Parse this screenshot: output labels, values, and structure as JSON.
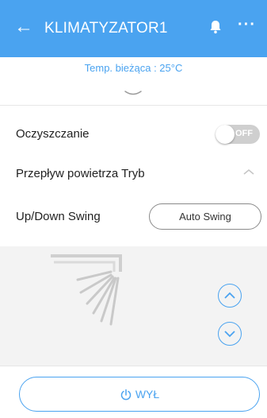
{
  "header": {
    "title": "KLIMATYZATOR1",
    "back_icon": "arrow-left-icon",
    "bell_icon": "bell-icon",
    "more_icon": "more-icon"
  },
  "temperature": {
    "label": "Temp. bieżąca : 25°C"
  },
  "rows": {
    "cleaning_label": "Oczyszczanie",
    "cleaning_toggle_text": "OFF",
    "airflow_label": "Przepływ powietrza Tryb",
    "swing_label": "Up/Down Swing",
    "swing_mode": "Auto Swing"
  },
  "power": {
    "label": "WYŁ"
  },
  "colors": {
    "accent": "#4aa3f0",
    "header_bg": "#4aa3f0",
    "toggle_off": "#cfcfcf",
    "panel_bg": "#f3f3f3"
  }
}
